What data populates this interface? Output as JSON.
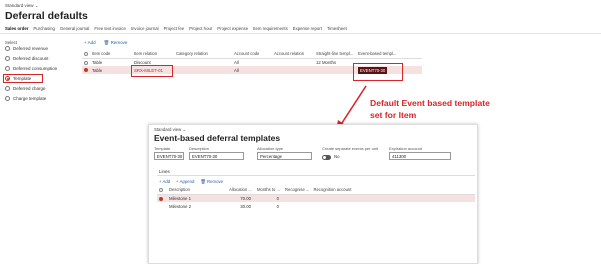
{
  "header": {
    "view_label": "Standard view ⌄",
    "title": "Deferral defaults"
  },
  "tabs": [
    "Sales order",
    "Purchasing",
    "General journal",
    "Free text invoice",
    "Invoice journal",
    "Project fee",
    "Project hour",
    "Project expense",
    "Item requirements",
    "Expense report",
    "Timesheet"
  ],
  "select": {
    "header": "Select",
    "options": [
      {
        "label": "Deferred revenue",
        "selected": false
      },
      {
        "label": "Deferred discount",
        "selected": false
      },
      {
        "label": "Deferred consumption",
        "selected": false
      },
      {
        "label": "Template",
        "selected": true
      },
      {
        "label": "Deferred charge",
        "selected": false
      },
      {
        "label": "Charge template",
        "selected": false
      }
    ]
  },
  "toolbar": {
    "add_label": "+ Add",
    "remove_label": "🗑 Remove"
  },
  "main_grid": {
    "columns": [
      "Item code",
      "Item relation",
      "Category relation",
      "Account code",
      "Account relation",
      "Straight-line templ...",
      "Event-based templ..."
    ],
    "rows": [
      {
        "item_code": "Table",
        "item_relation": "Discount",
        "category_relation": "",
        "account_code": "All",
        "account_relation": "",
        "straight_line": "12 Months",
        "event_based": "",
        "selected": false
      },
      {
        "item_code": "Table",
        "item_relation": "SRX-MILET-01",
        "category_relation": "",
        "account_code": "All",
        "account_relation": "",
        "straight_line": "",
        "event_based": "EVENT70-30",
        "selected": true
      }
    ]
  },
  "annotation": {
    "line1": "Default Event based template",
    "line2": "set for Item"
  },
  "inset": {
    "view_label": "Standard view ⌄",
    "title": "Event-based deferral templates",
    "fields": {
      "template_label": "Template",
      "template_value": "EVENT70-30",
      "description_label": "Description",
      "description_value": "EVENT70-30",
      "allocation_label": "Allocation type",
      "allocation_value": "Percentage",
      "separate_label": "Create separate events per unit",
      "separate_value": "No",
      "expiration_label": "Expiration account",
      "expiration_value": "411300"
    },
    "lines_label": "Lines",
    "toolbar": {
      "add_label": "+ Add",
      "append_label": "+ Append",
      "remove_label": "🗑 Remove"
    },
    "grid": {
      "columns": [
        "",
        "Description",
        "Allocation ...",
        "Months to ...",
        "Recognise ...",
        "Recognition account"
      ],
      "rows": [
        {
          "description": "Milestone 1",
          "allocation": "70.00",
          "months": "0",
          "recognise": "",
          "account": "",
          "selected": true
        },
        {
          "description": "Milestone 2",
          "allocation": "30.00",
          "months": "0",
          "recognise": "",
          "account": "",
          "selected": false
        }
      ]
    }
  },
  "colors": {
    "accent": "#d7262a",
    "link": "#2b5fa8",
    "selected_row": "#f6e1e1"
  }
}
